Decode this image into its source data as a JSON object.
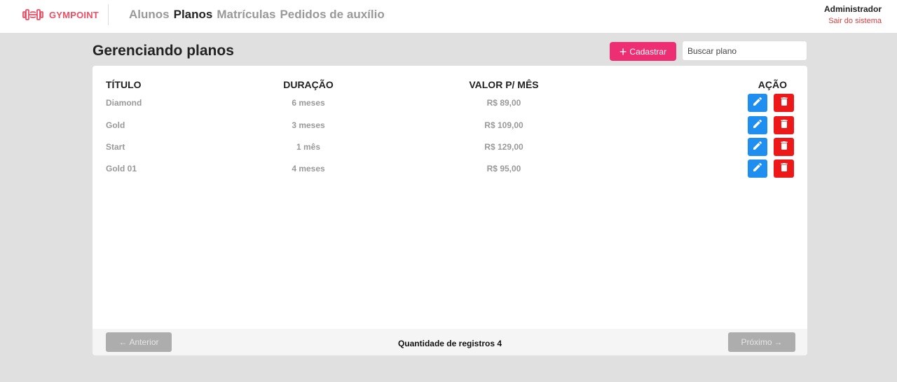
{
  "header": {
    "brand": "GYMPOINT",
    "nav": [
      {
        "label": "Alunos",
        "active": false
      },
      {
        "label": "Planos",
        "active": true
      },
      {
        "label": "Matrículas",
        "active": false
      },
      {
        "label": "Pedidos de auxílio",
        "active": false
      }
    ],
    "user_name": "Administrador",
    "logout_label": "Sair do sistema"
  },
  "page": {
    "title": "Gerenciando planos",
    "add_button_label": "Cadastrar",
    "search_placeholder": "Buscar plano"
  },
  "table": {
    "columns": [
      "TÍTULO",
      "DURAÇÃO",
      "VALOR P/ MÊS",
      "AÇÃO"
    ],
    "rows": [
      {
        "title": "Diamond",
        "duration": "6 meses",
        "price": "R$ 89,00"
      },
      {
        "title": "Gold",
        "duration": "3 meses",
        "price": "R$ 109,00"
      },
      {
        "title": "Start",
        "duration": "1 mês",
        "price": "R$ 129,00"
      },
      {
        "title": "Gold 01",
        "duration": "4 meses",
        "price": "R$ 95,00"
      }
    ]
  },
  "pagination": {
    "prev_label": "Anterior",
    "next_label": "Próximo",
    "count_text": "Quantidade de registros 4"
  },
  "colors": {
    "brand": "#ee4d64",
    "primary": "#ee2e72",
    "edit": "#1e8ef1",
    "delete": "#ef1818",
    "disabled": "#adadad"
  },
  "icons": [
    "dumbbell-icon",
    "plus-icon",
    "pencil-icon",
    "trash-icon",
    "arrow-left-icon",
    "arrow-right-icon"
  ]
}
